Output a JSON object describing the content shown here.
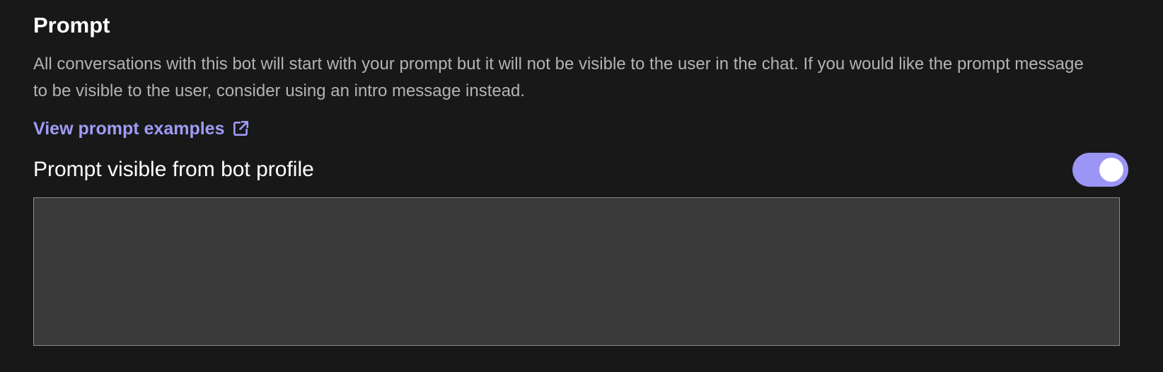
{
  "prompt_section": {
    "title": "Prompt",
    "description": "All conversations with this bot will start with your prompt but it will not be visible to the user in the chat. If you would like the prompt message to be visible to the user, consider using an intro message instead.",
    "examples_link": {
      "label": "View prompt examples",
      "icon": "external-link-icon"
    },
    "visibility_toggle": {
      "label": "Prompt visible from bot profile",
      "on": true
    },
    "prompt_input": {
      "value": "",
      "placeholder": ""
    }
  },
  "colors": {
    "background": "#181818",
    "accent": "#a09bf6",
    "description_text": "#b3b3b3",
    "input_background": "#3a3a3a",
    "input_border": "#8a8a8a"
  }
}
